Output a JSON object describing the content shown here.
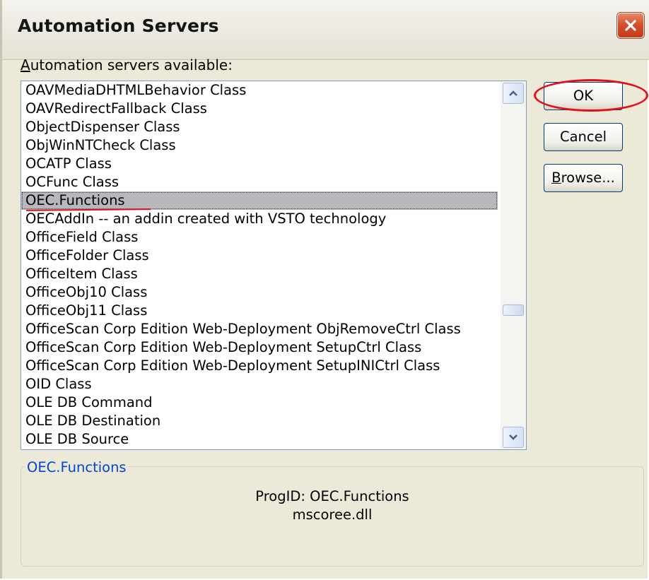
{
  "window": {
    "title": "Automation Servers"
  },
  "list": {
    "label_underlined": "A",
    "label_rest": "utomation servers available:",
    "items": [
      "OAVMediaDHTMLBehavior Class",
      "OAVRedirectFallback Class",
      "ObjectDispenser Class",
      "ObjWinNTCheck Class",
      "OCATP Class",
      "OCFunc Class",
      "OEC.Functions",
      "OECAddIn -- an addin created with VSTO technology",
      "OfficeField Class",
      "OfficeFolder Class",
      "OfficeItem Class",
      "OfficeObj10 Class",
      "OfficeObj11 Class",
      "OfficeScan Corp Edition Web-Deployment ObjRemoveCtrl Class",
      "OfficeScan Corp Edition Web-Deployment SetupCtrl Class",
      "OfficeScan Corp Edition Web-Deployment SetupINICtrl Class",
      "OID Class",
      "OLE DB Command",
      "OLE DB Destination",
      "OLE DB Source"
    ],
    "selected_index": 6
  },
  "buttons": {
    "ok": "OK",
    "cancel": "Cancel",
    "browse_underlined": "B",
    "browse_rest": "rowse..."
  },
  "details": {
    "legend": "OEC.Functions",
    "progid": "ProgID: OEC.Functions",
    "dll": "mscoree.dll"
  },
  "colors": {
    "dialog_bg": "#ece9d8",
    "annotation": "#e0101c",
    "legend_text": "#0046d5"
  },
  "icons": [
    "close-icon",
    "scroll-up-arrow-icon",
    "scroll-down-arrow-icon"
  ]
}
